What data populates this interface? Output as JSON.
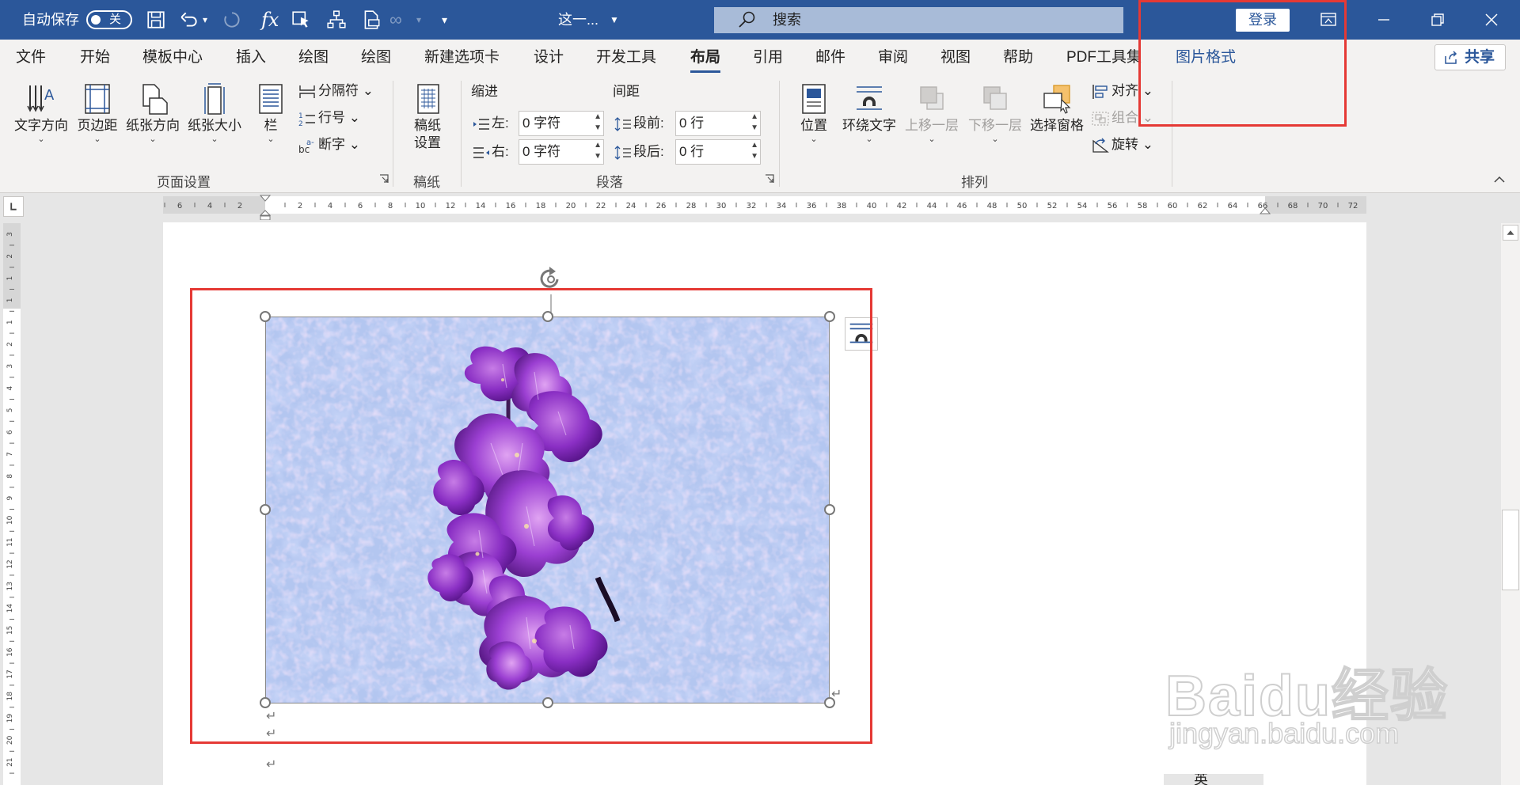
{
  "titlebar": {
    "autosave_label": "自动保存",
    "autosave_state": "关",
    "doc_title": "这一...",
    "search_placeholder": "搜索",
    "login_label": "登录"
  },
  "tabs": [
    "文件",
    "开始",
    "模板中心",
    "插入",
    "绘图",
    "绘图",
    "新建选项卡",
    "设计",
    "开发工具",
    "布局",
    "引用",
    "邮件",
    "审阅",
    "视图",
    "帮助",
    "PDF工具集",
    "图片格式"
  ],
  "active_tab": "布局",
  "share_label": "共享",
  "ribbon": {
    "page_setup": {
      "text_direction": "文字方向",
      "margins": "页边距",
      "orientation": "纸张方向",
      "size": "纸张大小",
      "columns": "栏",
      "breaks": "分隔符",
      "line_numbers": "行号",
      "hyphenation": "断字",
      "group_label": "页面设置"
    },
    "manuscript": {
      "button_line1": "稿纸",
      "button_line2": "设置",
      "group_label": "稿纸"
    },
    "paragraph": {
      "indent_title": "缩进",
      "spacing_title": "间距",
      "left_label": "左:",
      "left_value": "0 字符",
      "right_label": "右:",
      "right_value": "0 字符",
      "before_label": "段前:",
      "before_value": "0 行",
      "after_label": "段后:",
      "after_value": "0 行",
      "group_label": "段落"
    },
    "arrange": {
      "position": "位置",
      "wrap_text": "环绕文字",
      "bring_forward": "上移一层",
      "send_backward": "下移一层",
      "selection_pane": "选择窗格",
      "align": "对齐",
      "group": "组合",
      "rotate": "旋转",
      "group_label": "排列"
    }
  },
  "ruler": {
    "horizontal": [
      "6",
      "4",
      "2",
      "2",
      "4",
      "6",
      "8",
      "10",
      "12",
      "14",
      "16",
      "18",
      "20",
      "22",
      "24",
      "26",
      "28",
      "30",
      "32",
      "34",
      "36",
      "38",
      "40",
      "42",
      "44",
      "46",
      "48",
      "50",
      "52",
      "54",
      "56",
      "58",
      "60",
      "62",
      "64",
      "66",
      "68",
      "70",
      "72"
    ],
    "vertical": [
      "3",
      "2",
      "1",
      "1",
      "1",
      "2",
      "3",
      "4",
      "5",
      "6",
      "7",
      "8",
      "9",
      "10",
      "11",
      "12",
      "13",
      "14",
      "15",
      "16",
      "17",
      "18",
      "19",
      "20",
      "21"
    ]
  },
  "watermark": {
    "brand": "Baidu经验",
    "url": "jingyan.baidu.com"
  },
  "statusbar_fragment": "英",
  "colors": {
    "titlebar": "#2b579a",
    "highlight_box": "#e53935",
    "contextual_tab": "#2b579a"
  }
}
